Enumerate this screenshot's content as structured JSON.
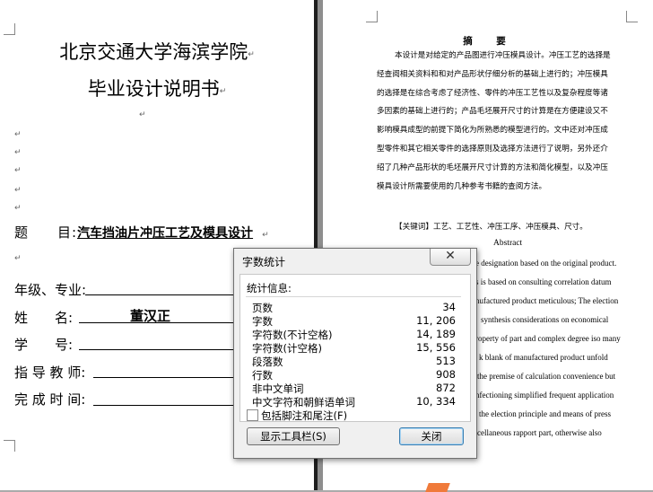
{
  "left_page": {
    "title_line1": "北京交通大学海滨学院",
    "title_line2": "毕业设计说明书",
    "topic_label": "题　　目:",
    "topic_value": "汽车挡油片冲压工艺及模具设计",
    "grade_label": "年级、专业:",
    "name_label": "姓　　名:",
    "name_value": "董汉正",
    "student_id_label": "学　　号:",
    "advisor_label": "指 导 教 师:",
    "completion_label": "完 成 时 间:"
  },
  "right_page": {
    "abstract_heading": "摘　要",
    "abstract_lines": [
      "本设计是对给定的产品图进行冲压模具设计。冲压工艺的选择是",
      "经查阅相关资料和和对产品形状仔细分析的基础上进行的；冲压模具",
      "的选择是在综合考虑了经济性、零件的冲压工艺性以及复杂程度等诸",
      "多因素的基础上进行的；产品毛坯展开尺寸的计算是在方便建设又不",
      "影响模具成型的前提下简化为所熟悉的模型进行的。文中还对冲压成",
      "型零件和其它相关零件的选择原则及选择方法进行了说明，另外还介",
      "绍了几种产品形状的毛坯展开尺寸计算的方法和简化模型，以及冲压",
      "模具设计所需要使用的几种参考书籍的查阅方法。"
    ],
    "keywords": "【关键词】工艺、工艺性、冲压工序、冲压模具、尺寸。",
    "english_heading": "Abstract",
    "english_lines": [
      "e designation based on the original product.",
      "s is based on consulting correlation datum",
      "nufactured product meticulous; The election",
      "synthesis considerations on economical",
      "roperty of part and complex degree iso many",
      "k blank of manufactured product unfold",
      "the premise of calculation convenience but",
      "nfectioning simplified frequent application",
      "the election principle and means of press",
      "cellaneous rapport part, otherwise also"
    ]
  },
  "dialog": {
    "title": "字数统计",
    "close_glyph": "✕",
    "section_label": "统计信息:",
    "stats": [
      {
        "label": "页数",
        "value": "34"
      },
      {
        "label": "字数",
        "value": "11, 206"
      },
      {
        "label": "字符数(不计空格)",
        "value": "14, 189"
      },
      {
        "label": "字符数(计空格)",
        "value": "15, 556"
      },
      {
        "label": "段落数",
        "value": "513"
      },
      {
        "label": "行数",
        "value": "908"
      },
      {
        "label": "非中文单词",
        "value": "872"
      },
      {
        "label": "中文字符和朝鲜语单词",
        "value": "10, 334"
      }
    ],
    "checkbox_label": "包括脚注和尾注(F)",
    "checkbox_checked": false,
    "toolbar_button": "显示工具栏(S)",
    "close_button": "关闭"
  },
  "colors": {
    "page_bg": "#ffffff",
    "workspace_bg": "#ababab",
    "dialog_bg": "#f0f0f0",
    "close_button_border": "#3c7fb1"
  }
}
